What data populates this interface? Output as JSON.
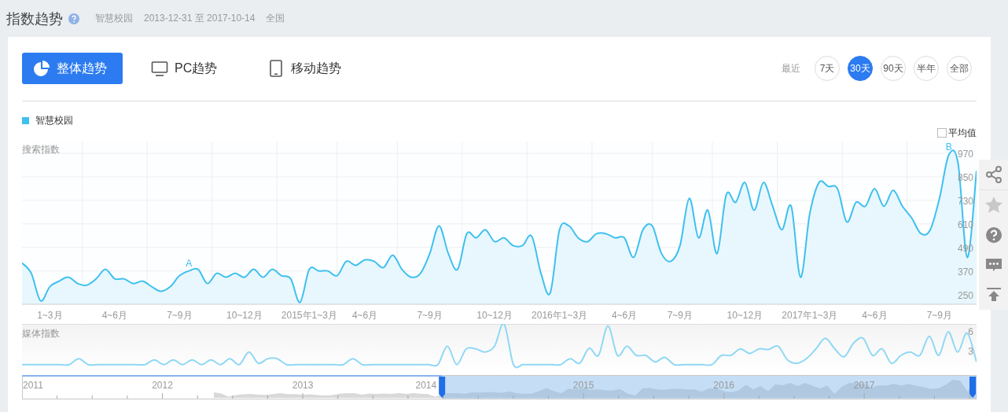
{
  "header": {
    "title": "指数趋势",
    "keyword": "智慧校园",
    "date_range": "2013-12-31 至 2017-10-14",
    "region": "全国"
  },
  "tabs": [
    {
      "label": "整体趋势",
      "selected": true,
      "kind": "overall"
    },
    {
      "label": "PC趋势",
      "selected": false,
      "kind": "pc"
    },
    {
      "label": "移动趋势",
      "selected": false,
      "kind": "mobile"
    }
  ],
  "recent": {
    "label": "最近",
    "options": [
      {
        "label": "7天",
        "selected": false
      },
      {
        "label": "30天",
        "selected": true
      },
      {
        "label": "90天",
        "selected": false
      },
      {
        "label": "半年",
        "selected": false
      },
      {
        "label": "全部",
        "selected": false
      }
    ]
  },
  "average": {
    "label": "平均值",
    "checked": false
  },
  "search_index": {
    "chart_data": {
      "type": "area",
      "ylabel": "搜索指数",
      "grid": true,
      "ylim": [
        200,
        1030
      ],
      "yticks": [
        250,
        370,
        490,
        610,
        730,
        850,
        970
      ],
      "categories": [
        null,
        null,
        null,
        "1~3月",
        null,
        null,
        null,
        null,
        null,
        null,
        "4~6月",
        null,
        null,
        null,
        null,
        null,
        null,
        "7~9月",
        null,
        null,
        null,
        null,
        null,
        null,
        "10~12月",
        null,
        null,
        null,
        null,
        null,
        null,
        "2015年1~3月",
        null,
        null,
        null,
        null,
        null,
        "4~6月",
        null,
        null,
        null,
        null,
        null,
        null,
        "7~9月",
        null,
        null,
        null,
        null,
        null,
        null,
        "10~12月",
        null,
        null,
        null,
        null,
        null,
        null,
        "2016年1~3月",
        null,
        null,
        null,
        null,
        null,
        null,
        "4~6月",
        null,
        null,
        null,
        null,
        null,
        "7~9月",
        null,
        null,
        null,
        null,
        null,
        null,
        "10~12月",
        null,
        null,
        null,
        null,
        null,
        null,
        "2017年1~3月",
        null,
        null,
        null,
        null,
        null,
        null,
        "4~6月",
        null,
        null,
        null,
        null,
        null,
        null,
        "7~9月",
        null,
        null,
        null,
        null
      ],
      "series": [
        {
          "name": "智慧校园",
          "color": "#3ec0ef",
          "values": [
            411,
            358,
            218,
            290,
            318,
            338,
            306,
            298,
            330,
            378,
            330,
            330,
            306,
            318,
            290,
            266,
            290,
            346,
            370,
            378,
            306,
            358,
            338,
            358,
            338,
            378,
            338,
            378,
            346,
            330,
            210,
            378,
            370,
            370,
            346,
            419,
            399,
            427,
            419,
            387,
            451,
            378,
            338,
            358,
            459,
            600,
            459,
            378,
            560,
            539,
            580,
            519,
            539,
            499,
            499,
            547,
            358,
            258,
            580,
            600,
            539,
            519,
            560,
            560,
            539,
            539,
            439,
            580,
            600,
            459,
            419,
            499,
            740,
            539,
            680,
            459,
            760,
            720,
            821,
            680,
            821,
            700,
            580,
            700,
            338,
            660,
            821,
            801,
            789,
            620,
            720,
            700,
            789,
            700,
            781,
            700,
            640,
            560,
            580,
            740,
            961,
            921,
            439,
            881
          ]
        }
      ],
      "annotations": [
        {
          "y": 370,
          "text": "A"
        },
        {
          "y": 961,
          "text": "B"
        }
      ]
    }
  },
  "media_index": {
    "chart_data": {
      "type": "line",
      "ylabel": "媒体指数",
      "ylim": [
        0,
        7.2
      ],
      "yticks": [
        3,
        6
      ],
      "series": [
        {
          "color": "#8fd8f5",
          "values": [
            1,
            1,
            1,
            1,
            1,
            1,
            1.9,
            1,
            1,
            1,
            1,
            1,
            1,
            1,
            1.7,
            1,
            1.7,
            1,
            1.7,
            1,
            1.7,
            1,
            1.9,
            1,
            2.9,
            1.2,
            1.9,
            1.9,
            1,
            1,
            1,
            1,
            1,
            1,
            1,
            1.9,
            1,
            1,
            1,
            1,
            1,
            1,
            1,
            1,
            1,
            3.8,
            1,
            3.4,
            3.4,
            2.9,
            3.8,
            7.2,
            1,
            1,
            1,
            1,
            1,
            1,
            1.9,
            1.2,
            3.5,
            2.4,
            6.9,
            2.4,
            3.8,
            2.4,
            2.4,
            1.4,
            2.1,
            1,
            1,
            1,
            1,
            1,
            2.4,
            2.4,
            3.4,
            2.7,
            3.4,
            3.3,
            3.8,
            1.7,
            1.2,
            1.9,
            3.4,
            5,
            3.4,
            2.2,
            4.3,
            5,
            2.4,
            3.4,
            1.2,
            2.4,
            2.9,
            2.4,
            5.3,
            2.4,
            6,
            2.9,
            5.8,
            1.4
          ]
        }
      ]
    }
  },
  "navigator": {
    "years": [
      "2011",
      "2012",
      "2013",
      "2014",
      "2015",
      "2016",
      "2017"
    ],
    "level": 0.56
  }
}
